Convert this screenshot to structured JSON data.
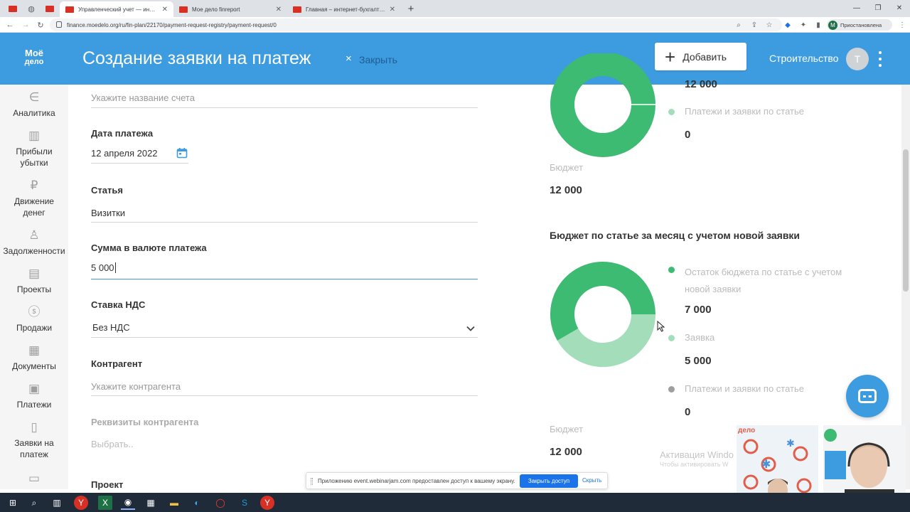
{
  "browser": {
    "tabs": [
      {
        "label": "Управленческий учет — интерн",
        "active": true
      },
      {
        "label": "Мое дело finreport",
        "active": false
      },
      {
        "label": "Главная – интернет-бухгалтер",
        "active": false
      }
    ],
    "url": "finance.moedelo.org/ru/fin-plan/22170/payment-request-registry/payment-request/0",
    "profile_label": "Приостановлена",
    "profile_initial": "M"
  },
  "header": {
    "logo_line1": "Моё",
    "logo_line2": "дело",
    "title": "Создание заявки на платеж",
    "close_label": "Закрыть",
    "add_label": "Добавить",
    "company": "Строительство",
    "avatar_initial": "Т"
  },
  "sidebar": {
    "items": [
      {
        "label": "Аналитика",
        "icon": "analytics-icon"
      },
      {
        "label": "Прибыли убытки",
        "icon": "bar-chart-icon"
      },
      {
        "label": "Движение денег",
        "icon": "ruble-flow-icon"
      },
      {
        "label": "Задолженности",
        "icon": "person-debt-icon"
      },
      {
        "label": "Проекты",
        "icon": "briefcase-icon"
      },
      {
        "label": "Продажи",
        "icon": "dollar-icon"
      },
      {
        "label": "Документы",
        "icon": "document-icon"
      },
      {
        "label": "Платежи",
        "icon": "wallet-icon"
      },
      {
        "label": "Заявки на платеж",
        "icon": "request-icon"
      }
    ]
  },
  "form": {
    "account_placeholder": "Укажите название счета",
    "date_label": "Дата платежа",
    "date_value": "12 апреля 2022",
    "article_label": "Статья",
    "article_value": "Визитки",
    "amount_label": "Сумма в валюте платежа",
    "amount_value": "5 000",
    "vat_label": "Ставка НДС",
    "vat_value": "Без НДС",
    "counterparty_label": "Контрагент",
    "counterparty_placeholder": "Укажите контрагента",
    "requisites_label": "Реквизиты контрагента",
    "requisites_placeholder": "Выбрать..",
    "project_label": "Проект"
  },
  "chart_top": {
    "value_top": "12 000",
    "legend_payments": "Платежи и заявки по статье",
    "legend_payments_value": "0",
    "budget_label": "Бюджет",
    "budget_value": "12 000"
  },
  "chart_data": {
    "type": "pie",
    "title": "Бюджет по статье за месяц с учетом новой заявки",
    "series": [
      {
        "name": "Остаток бюджета по статье с учетом новой заявки",
        "value": 7000,
        "display": "7 000",
        "color": "#3dbb72"
      },
      {
        "name": "Заявка",
        "value": 5000,
        "display": "5 000",
        "color": "#a3ddb9"
      },
      {
        "name": "Платежи и заявки по статье",
        "value": 0,
        "display": "0",
        "color": "#9e9e9e"
      }
    ],
    "budget_label": "Бюджет",
    "budget_value": "12 000"
  },
  "chart_bottom_legend": {
    "remaining_line1": "Остаток бюджета по статье с учетом",
    "remaining_line2": "новой заявки"
  },
  "watermark": {
    "line1": "Активация Windo",
    "line2": "Чтобы активировать W"
  },
  "share_bar": {
    "message": "Приложению event.webinarjam.com предоставлен доступ к вашему экрану.",
    "stop_label": "Закрыть доступ",
    "hide_label": "Скрыть"
  },
  "video_overlay": {
    "brand": "дело"
  },
  "colors": {
    "header_blue": "#3d9be0",
    "donut_green": "#3dbb72",
    "donut_light_green": "#a3ddb9"
  }
}
